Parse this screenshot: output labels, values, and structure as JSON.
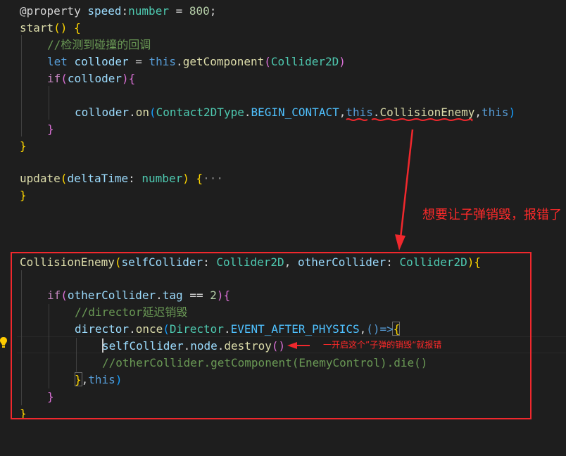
{
  "code": {
    "l1": {
      "decorator": "@property",
      "name": "speed",
      "colon": ":",
      "type": "number",
      "eq": " = ",
      "value": "800",
      "semi": ";"
    },
    "l2": {
      "fn": "start",
      "parens": "()",
      "brace": " {"
    },
    "l3": {
      "comment": "//检测到碰撞的回调"
    },
    "l4": {
      "kw": "let",
      "var": " colloder",
      "eq": " = ",
      "this": "this",
      "dot": ".",
      "fn": "getComponent",
      "open": "(",
      "type": "Collider2D",
      "close": ")"
    },
    "l5": {
      "kw": "if",
      "open": "(",
      "var": "colloder",
      "close": ")",
      "brace": "{"
    },
    "l7": {
      "var": "colloder",
      "dot": ".",
      "fn": "on",
      "open": "(",
      "type": "Contact2DType",
      "dot2": ".",
      "const": "BEGIN_CONTACT",
      "comma": ",",
      "this1": "this",
      "dot3": ".",
      "fn2": "CollisionEnemy",
      "comma2": ",",
      "this2": "this",
      "close": ")"
    },
    "l8": {
      "brace": "}"
    },
    "l9": {
      "brace": "}"
    },
    "l11": {
      "fn": "update",
      "open": "(",
      "param": "deltaTime",
      "colon": ": ",
      "type": "number",
      "close": ")",
      "brace": " {",
      "ellipsis": "···"
    },
    "l12": {
      "brace": "}"
    },
    "l16": {
      "fn": "CollisionEnemy",
      "open": "(",
      "p1": "selfCollider",
      "c1": ": ",
      "t1": "Collider2D",
      "comma": ", ",
      "p2": "otherCollider",
      "c2": ": ",
      "t2": "Collider2D",
      "close": ")",
      "brace": "{"
    },
    "l18": {
      "kw": "if",
      "open": "(",
      "var": "otherCollider",
      "dot": ".",
      "prop": "tag",
      "op": " == ",
      "num": "2",
      "close": ")",
      "brace": "{"
    },
    "l19": {
      "comment": "//director延迟销毁"
    },
    "l20": {
      "var": "director",
      "dot": ".",
      "fn": "once",
      "open": "(",
      "type": "Director",
      "dot2": ".",
      "const": "EVENT_AFTER_PHYSICS",
      "comma": ",",
      "arrow": "()=>",
      "brace": "{"
    },
    "l21": {
      "var": "selfCollider",
      "dot": ".",
      "prop": "node",
      "dot2": ".",
      "fn": "destroy",
      "parens": "()"
    },
    "l22": {
      "comment": "//otherCollider.getComponent(EnemyControl).die()"
    },
    "l23": {
      "brace": "}",
      "comma": ",",
      "this": "this",
      "close": ")"
    },
    "l24": {
      "brace": "}"
    },
    "l25": {
      "brace": "}"
    }
  },
  "annotations": {
    "main": "想要让子弹销毁，报错了",
    "side": "一开启这个”子弹的销毁“就报错"
  },
  "colors": {
    "background": "#1e1e1e",
    "annotation": "#f0282d"
  },
  "icons": {
    "lightbulb": "lightbulb-icon"
  }
}
